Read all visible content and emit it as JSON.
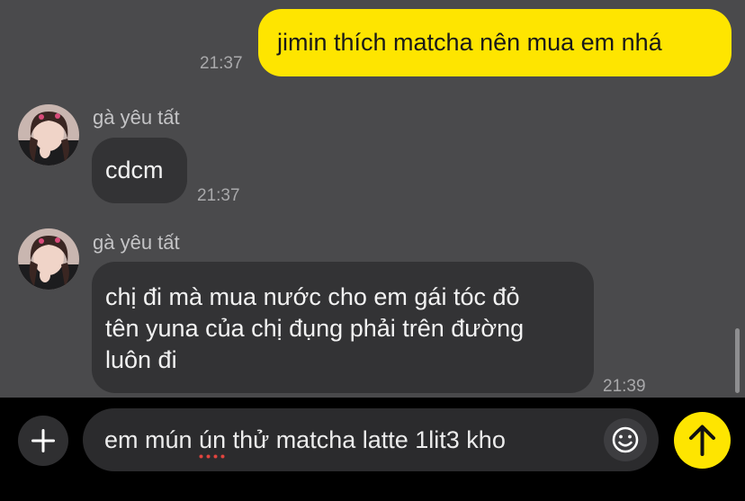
{
  "messages": [
    {
      "direction": "outgoing",
      "text": "jimin thích matcha nên mua em nhá",
      "time": "21:37"
    },
    {
      "direction": "incoming",
      "sender": "gà yêu tất",
      "text": "cdcm",
      "time": "21:37"
    },
    {
      "direction": "incoming",
      "sender": "gà yêu tất",
      "lines": [
        "chị đi mà mua nước cho em gái tóc đỏ",
        "tên yuna của chị đụng phải trên đường",
        "luôn đi"
      ],
      "time": "21:39"
    }
  ],
  "composer": {
    "text_before": "em mún ",
    "misspelled_word": "ún",
    "text_after": " thử matcha latte 1lit3 kho",
    "icons": {
      "attach": "plus-icon",
      "emoji": "smile-icon",
      "send": "arrow-up-icon"
    }
  },
  "colors": {
    "chat_background": "#4a4a4c",
    "outgoing_bubble": "#fee500",
    "incoming_bubble": "#333335",
    "send_button": "#fee500",
    "composer_background": "#000000"
  }
}
